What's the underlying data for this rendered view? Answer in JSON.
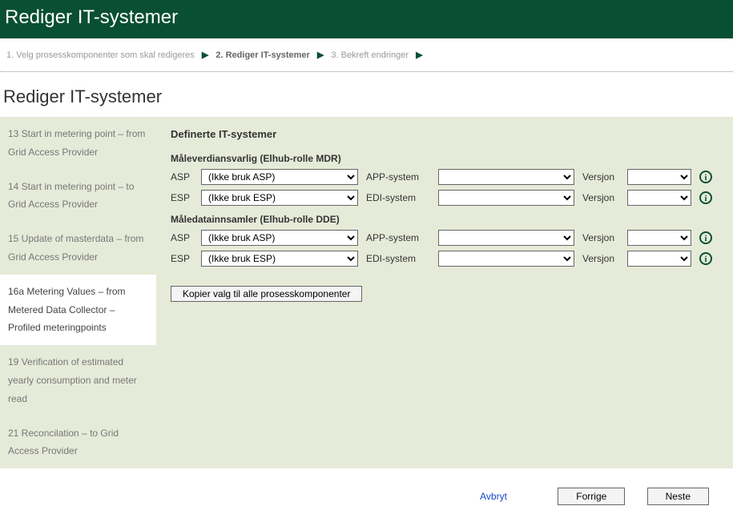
{
  "header": {
    "title": "Rediger IT-systemer"
  },
  "breadcrumb": {
    "step1": "1. Velg prosesskomponenter som skal redigeres",
    "step2": "2. Rediger IT-systemer",
    "step3": "3. Bekreft endringer"
  },
  "page": {
    "title": "Rediger IT-systemer"
  },
  "sidebar": {
    "items": [
      {
        "label": "13 Start in metering point – from Grid Access Provider"
      },
      {
        "label": "14 Start in metering point – to Grid Access Provider"
      },
      {
        "label": "15 Update of masterdata – from Grid Access Provider"
      },
      {
        "label": "16a Metering Values – from Metered Data Collector – Profiled meteringpoints"
      },
      {
        "label": "19 Verification of estimated yearly consumption and meter read"
      },
      {
        "label": "21 Reconcilation – to Grid Access Provider"
      }
    ]
  },
  "content": {
    "heading": "Definerte IT-systemer",
    "section1": {
      "title": "Måleverdiansvarlig (Elhub-rolle MDR)",
      "row1": {
        "lbl": "ASP",
        "sel": "(Ikke bruk ASP)",
        "mid_lbl": "APP-system",
        "ver_lbl": "Versjon"
      },
      "row2": {
        "lbl": "ESP",
        "sel": "(Ikke bruk ESP)",
        "mid_lbl": "EDI-system",
        "ver_lbl": "Versjon"
      }
    },
    "section2": {
      "title": "Måledatainnsamler (Elhub-rolle DDE)",
      "row1": {
        "lbl": "ASP",
        "sel": "(Ikke bruk ASP)",
        "mid_lbl": "APP-system",
        "ver_lbl": "Versjon"
      },
      "row2": {
        "lbl": "ESP",
        "sel": "(Ikke bruk ESP)",
        "mid_lbl": "EDI-system",
        "ver_lbl": "Versjon"
      }
    },
    "copy_button": "Kopier valg til alle prosesskomponenter"
  },
  "footer": {
    "cancel": "Avbryt",
    "prev": "Forrige",
    "next": "Neste"
  }
}
